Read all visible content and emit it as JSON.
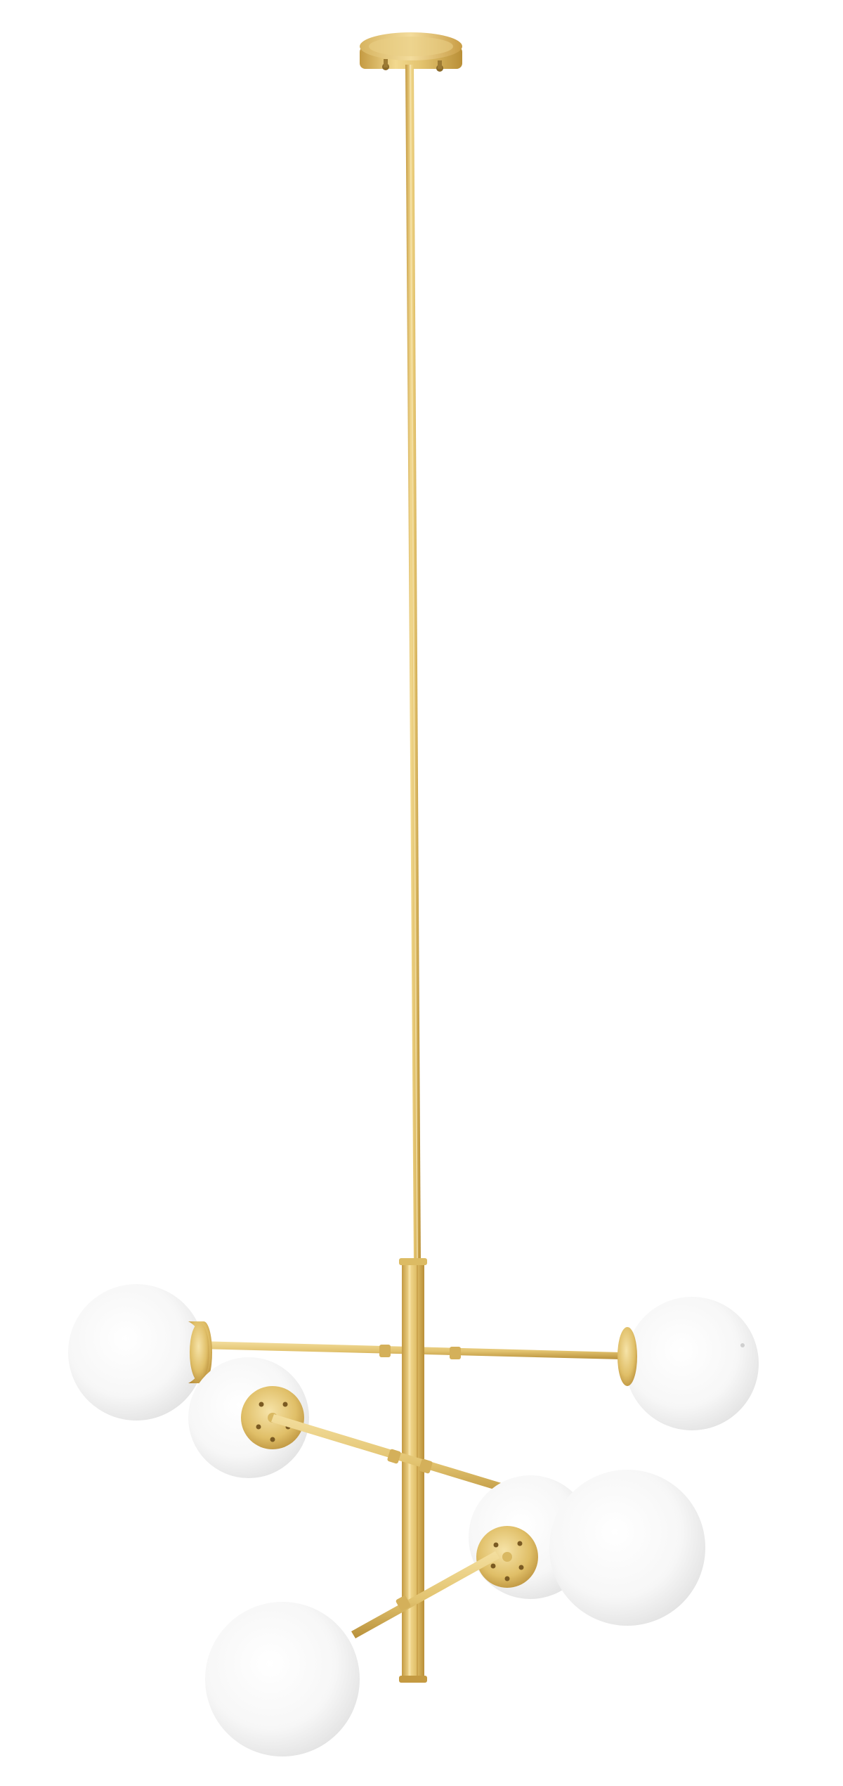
{
  "image": {
    "subject": "pendant-light",
    "background_color": "#ffffff",
    "colors": {
      "brass_light": "#f3dc9a",
      "brass_mid": "#e0c06a",
      "brass_dark": "#b98f37",
      "glass_light": "#ffffff",
      "glass_mid": "#f3f3f3",
      "glass_edge": "#d9d9d9"
    },
    "globe_count": 6
  }
}
